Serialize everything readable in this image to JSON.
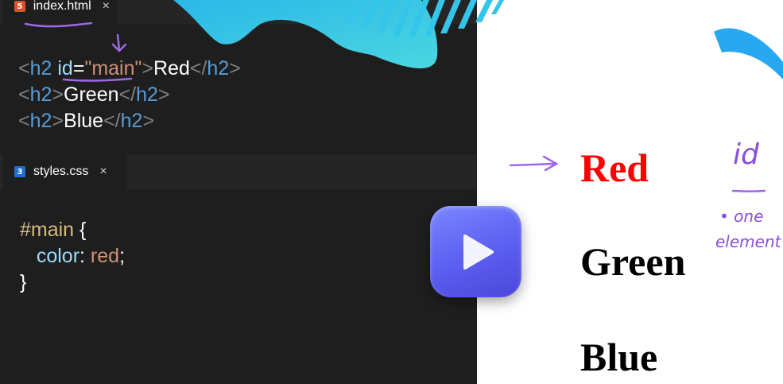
{
  "editor": {
    "html_tab": {
      "label": "index.html",
      "icon": "html5-icon",
      "close": "×"
    },
    "css_tab": {
      "label": "styles.css",
      "icon": "css3-icon",
      "close": "×"
    },
    "html_lines": [
      {
        "open_lt": "<",
        "tag": "h2",
        "attr": "id",
        "eq": "=",
        "value": "\"main\"",
        "gt": ">",
        "text": "Red",
        "close_lt": "</",
        "close_tag": "h2",
        "close_gt": ">"
      },
      {
        "open_lt": "<",
        "tag": "h2",
        "gt": ">",
        "text": "Green",
        "close_lt": "</",
        "close_tag": "h2",
        "close_gt": ">"
      },
      {
        "open_lt": "<",
        "tag": "h2",
        "gt": ">",
        "text": "Blue",
        "close_lt": "</",
        "close_tag": "h2",
        "close_gt": ">"
      }
    ],
    "css_lines": {
      "selector": "#main",
      "open_brace": " {",
      "property": "color",
      "colon": ":",
      "value": " red",
      "semicolon": ";",
      "close_brace": "}"
    }
  },
  "preview": {
    "headings": [
      "Red",
      "Green",
      "Blue"
    ],
    "annotations": {
      "label": "id",
      "note_line1": "• one",
      "note_line2": "element"
    }
  },
  "colors": {
    "accent_purple": "#8a4fe0",
    "play_button": "#5b5ef0",
    "red_text": "#ff0000",
    "decor_cyan": "#34c6ea"
  },
  "play_button": {
    "icon": "play-icon"
  }
}
